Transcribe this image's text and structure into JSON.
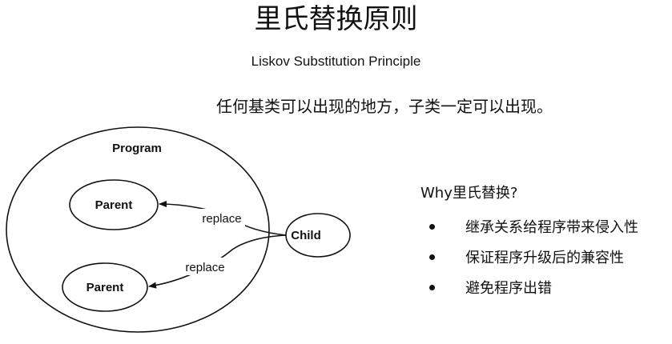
{
  "title": "里氏替换原则",
  "subtitle": "Liskov Substitution Principle",
  "statement": "任何基类可以出现的地方，子类一定可以出现。",
  "diagram": {
    "program_label": "Program",
    "parents": [
      {
        "label": "Parent"
      },
      {
        "label": "Parent"
      }
    ],
    "child_label": "Child",
    "edges": [
      {
        "label": "replace"
      },
      {
        "label": "replace"
      }
    ]
  },
  "why": {
    "heading": "Why里氏替换?",
    "reasons": [
      "继承关系给程序带来侵入性",
      "保证程序升级后的兼容性",
      "避免程序出错"
    ]
  },
  "colors": {
    "stroke": "#111111",
    "background": "#ffffff"
  }
}
